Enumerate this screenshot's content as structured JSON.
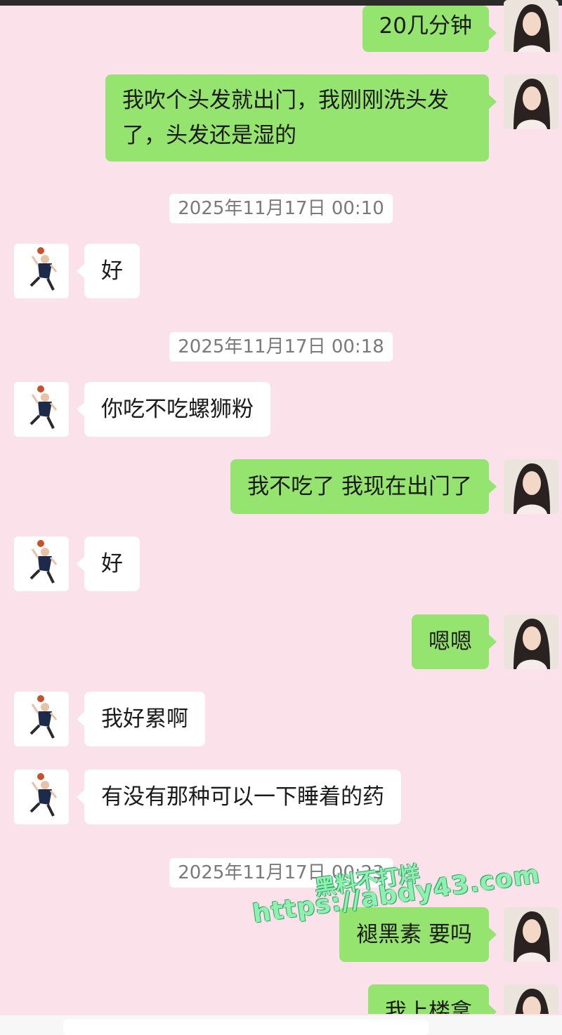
{
  "messages": [
    {
      "side": "self",
      "text": "20几分钟"
    },
    {
      "side": "self",
      "text": "我吹个头发就出门，我刚刚洗头发了，头发还是湿的"
    },
    {
      "timestamp": "2025年11月17日 00:10"
    },
    {
      "side": "other",
      "text": "好"
    },
    {
      "timestamp": "2025年11月17日 00:18"
    },
    {
      "side": "other",
      "text": "你吃不吃螺狮粉"
    },
    {
      "side": "self",
      "text": "我不吃了 我现在出门了"
    },
    {
      "side": "other",
      "text": "好"
    },
    {
      "side": "self",
      "text": "嗯嗯"
    },
    {
      "side": "other",
      "text": "我好累啊"
    },
    {
      "side": "other",
      "text": "有没有那种可以一下睡着的药"
    },
    {
      "timestamp": "2025年11月17日 00:23"
    },
    {
      "side": "self",
      "text": "褪黑素 要吗"
    },
    {
      "side": "self",
      "text": "我上楼拿"
    }
  ],
  "watermark": {
    "title": "黑料不打烊",
    "url": "https://abdy43.com"
  },
  "colors": {
    "background": "#fbe1ea",
    "self_bubble": "#95e46f",
    "other_bubble": "#ffffff"
  },
  "icons": {
    "self_avatar": "woman-portrait-avatar",
    "other_avatar": "basketball-player-avatar"
  }
}
